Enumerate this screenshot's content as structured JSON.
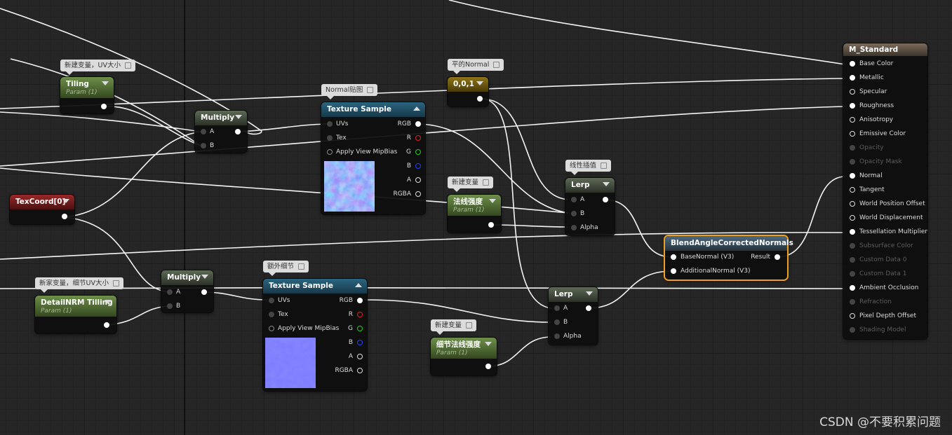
{
  "nodes": {
    "tiling": {
      "title": "Tiling",
      "subtitle": "Param (1)",
      "comment": "新建变量，UV大小"
    },
    "multiply1": {
      "title": "Multiply",
      "pin_a": "A",
      "pin_b": "B"
    },
    "tex_sample1": {
      "title": "Texture Sample",
      "comment": "Normal贴图",
      "inputs": [
        "UVs",
        "Tex",
        "Apply View MipBias"
      ],
      "outputs": [
        "RGB",
        "R",
        "G",
        "B",
        "A",
        "RGBA"
      ]
    },
    "const_001": {
      "title": "0,0,1",
      "comment": "平的Normal"
    },
    "texcoord": {
      "title": "TexCoord[0]"
    },
    "normal_strength": {
      "title": "法线强度",
      "subtitle": "Param (1)",
      "comment": "新建变量"
    },
    "lerp1": {
      "title": "Lerp",
      "comment": "线性插值",
      "pins": [
        "A",
        "B",
        "Alpha"
      ]
    },
    "blend": {
      "title": "BlendAngleCorrectedNormals",
      "inputs": [
        "BaseNormal (V3)",
        "AdditionalNormal (V3)"
      ],
      "output": "Result"
    },
    "detail_tiling": {
      "title": "DetailNRM Tilling",
      "subtitle": "Param (1)",
      "comment": "新家变量，细节UV大小"
    },
    "multiply2": {
      "title": "Multiply",
      "pin_a": "A",
      "pin_b": "B"
    },
    "tex_sample2": {
      "title": "Texture Sample",
      "comment": "额外细节",
      "inputs": [
        "UVs",
        "Tex",
        "Apply View MipBias"
      ],
      "outputs": [
        "RGB",
        "R",
        "G",
        "B",
        "A",
        "RGBA"
      ]
    },
    "detail_strength": {
      "title": "细节法线强度",
      "subtitle": "Param (1)",
      "comment": "新建变量"
    },
    "lerp2": {
      "title": "Lerp",
      "pins": [
        "A",
        "B",
        "Alpha"
      ]
    },
    "material": {
      "title": "M_Standard",
      "pins": [
        {
          "label": "Base Color",
          "active": true
        },
        {
          "label": "Metallic",
          "active": true
        },
        {
          "label": "Specular",
          "active": true
        },
        {
          "label": "Roughness",
          "active": true
        },
        {
          "label": "Anisotropy",
          "active": true
        },
        {
          "label": "Emissive Color",
          "active": true
        },
        {
          "label": "Opacity",
          "active": false
        },
        {
          "label": "Opacity Mask",
          "active": false
        },
        {
          "label": "Normal",
          "active": true
        },
        {
          "label": "Tangent",
          "active": true
        },
        {
          "label": "World Position Offset",
          "active": true
        },
        {
          "label": "World Displacement",
          "active": true
        },
        {
          "label": "Tessellation Multiplier",
          "active": true
        },
        {
          "label": "Subsurface Color",
          "active": false
        },
        {
          "label": "Custom Data 0",
          "active": false
        },
        {
          "label": "Custom Data 1",
          "active": false
        },
        {
          "label": "Ambient Occlusion",
          "active": true
        },
        {
          "label": "Refraction",
          "active": false
        },
        {
          "label": "Pixel Depth Offset",
          "active": true
        },
        {
          "label": "Shading Model",
          "active": false
        }
      ]
    }
  },
  "colors": {
    "background": "#262626",
    "selection": "#f0a020",
    "wire": "#ffffff",
    "normal_map": "#4848e8",
    "detail_map": "#7878ff"
  },
  "watermark": "CSDN @不要积累问题"
}
